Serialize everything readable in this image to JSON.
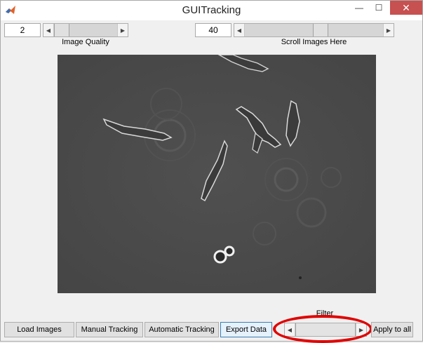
{
  "window": {
    "title": "GUITracking",
    "minimize": "—",
    "maximize": "☐",
    "close": "✕"
  },
  "controls": {
    "quality_value": "2",
    "quality_label": "Image Quality",
    "scroll_value": "40",
    "scroll_label": "Scroll Images Here",
    "filter_label": "Filter"
  },
  "buttons": {
    "load": "Load Images",
    "manual": "Manual Tracking",
    "automatic": "Automatic Tracking",
    "export": "Export Data",
    "apply_all": "Apply to all"
  },
  "icons": {
    "left": "◀",
    "right": "▶"
  },
  "colors": {
    "highlight": "#e00000",
    "image_bg": "#4a4a4a"
  }
}
